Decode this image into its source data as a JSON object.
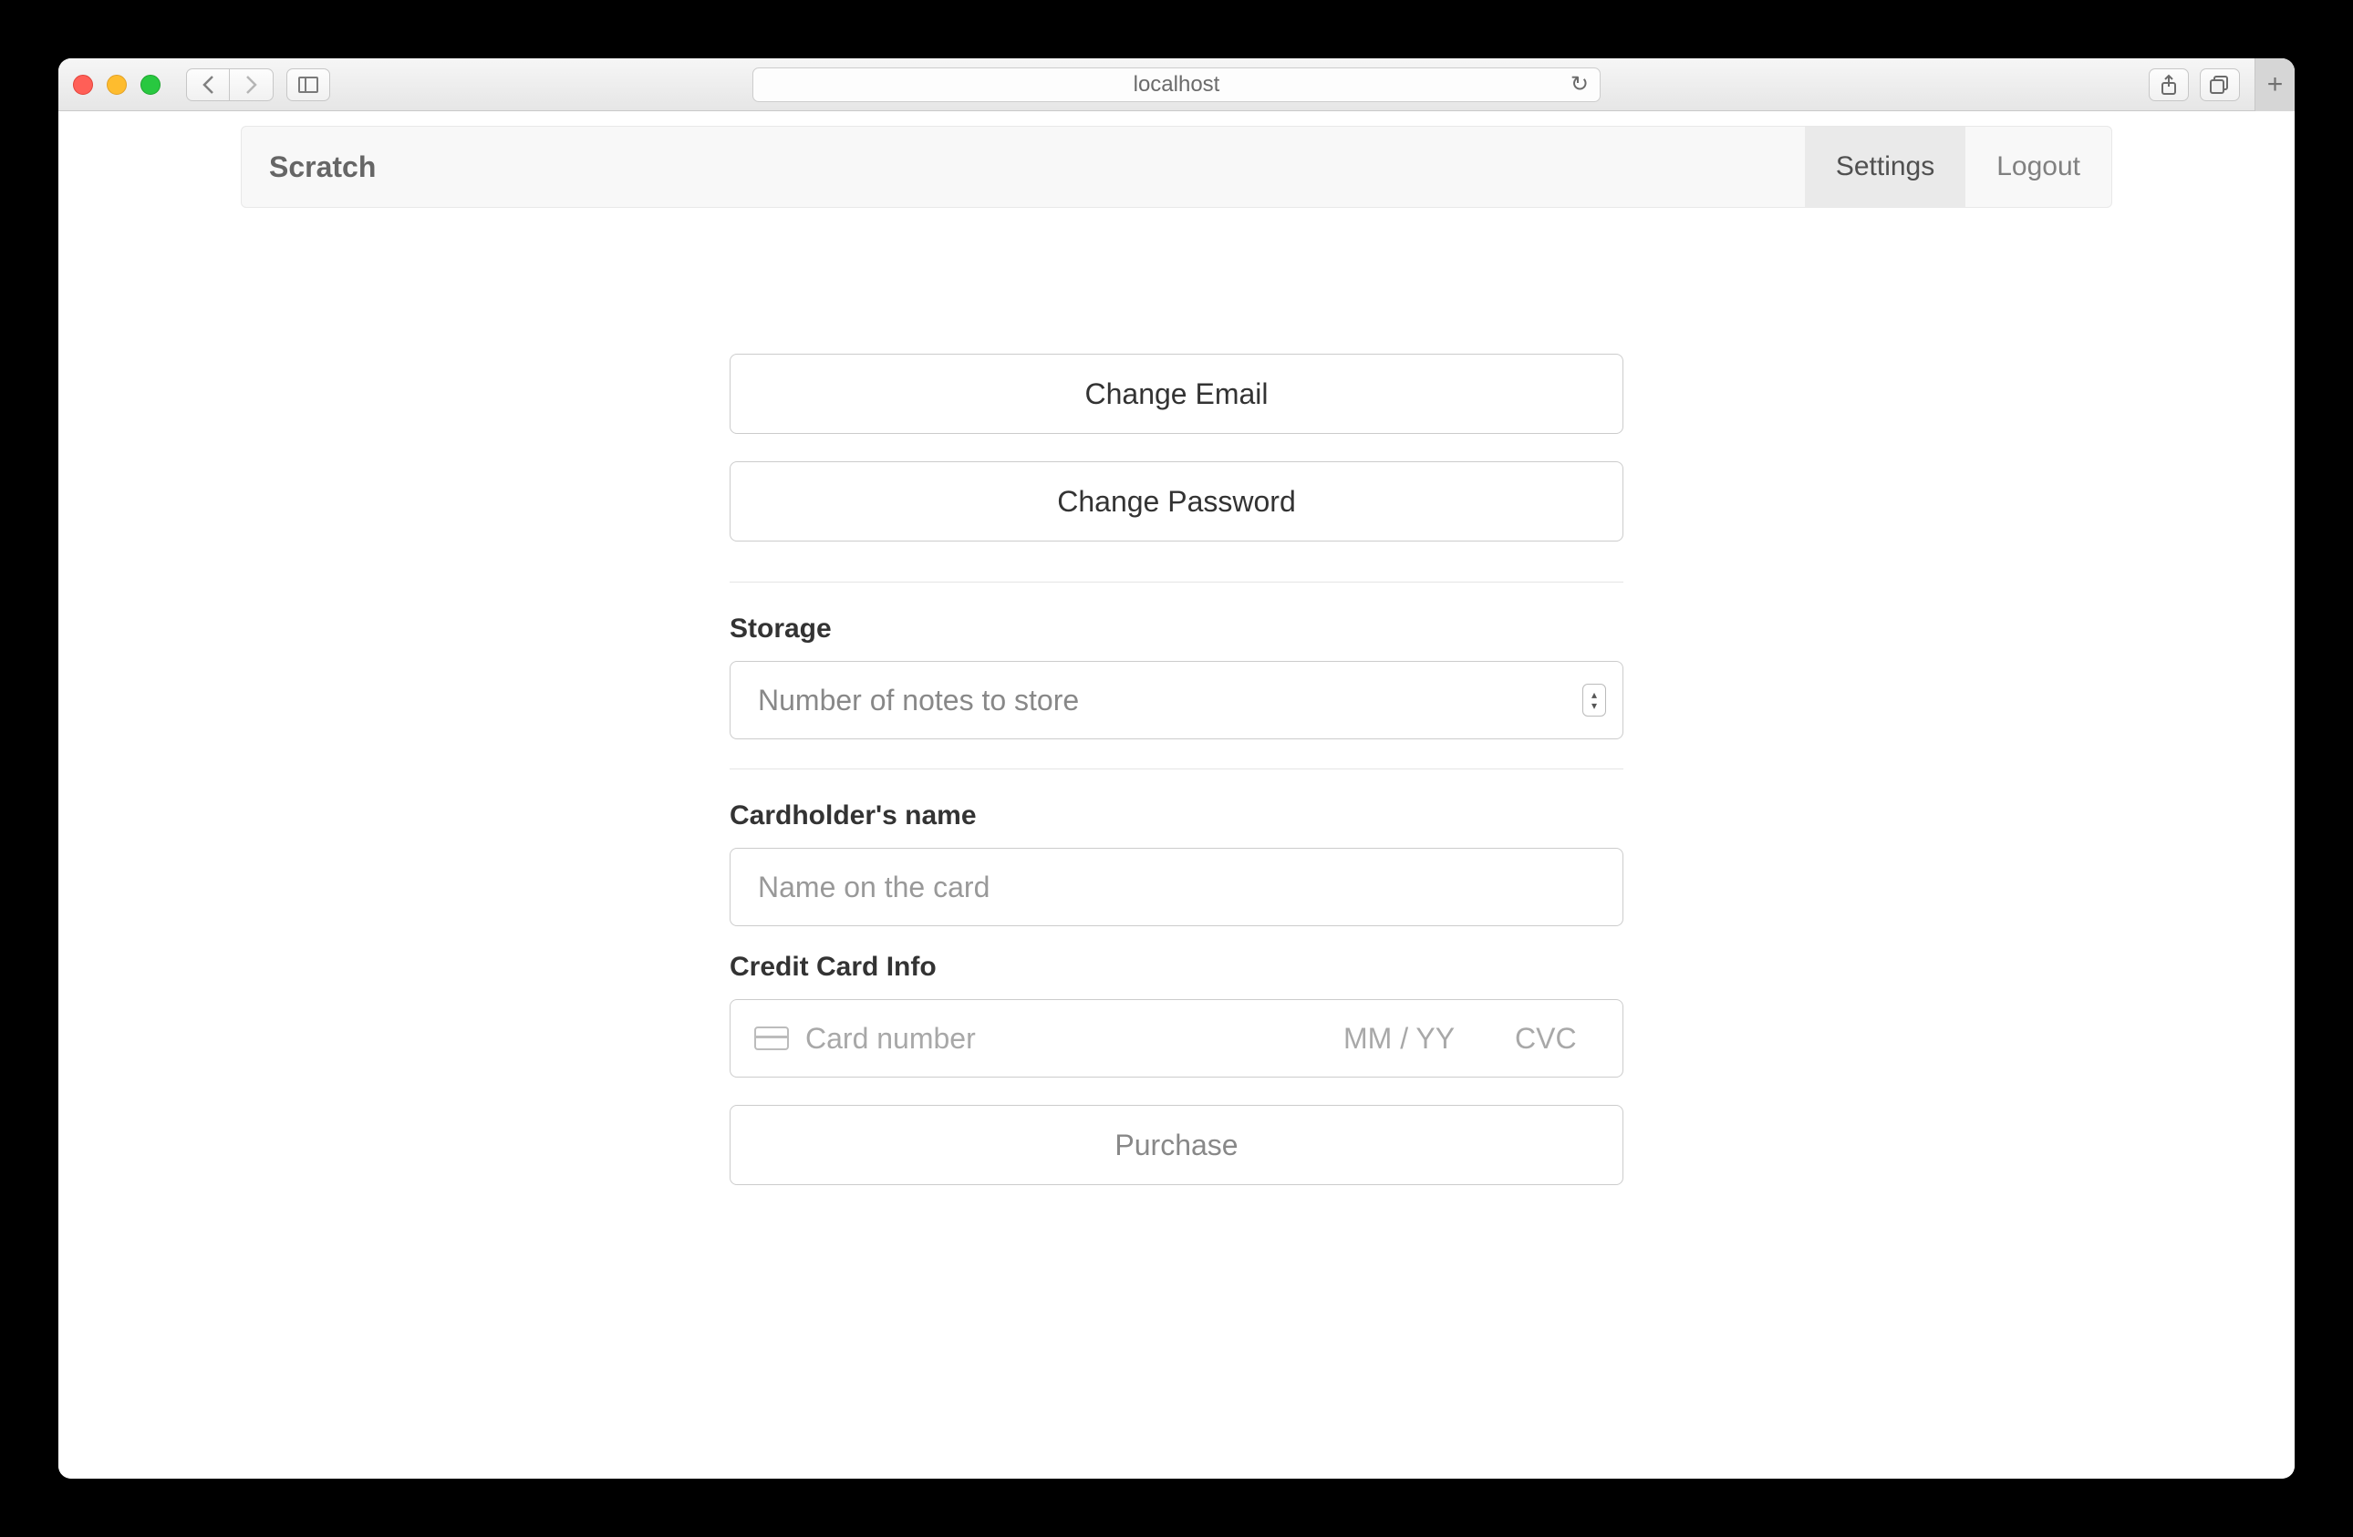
{
  "browser": {
    "url_display": "localhost"
  },
  "nav": {
    "brand": "Scratch",
    "settings": "Settings",
    "logout": "Logout"
  },
  "buttons": {
    "change_email": "Change Email",
    "change_password": "Change Password",
    "purchase": "Purchase"
  },
  "storage": {
    "label": "Storage",
    "placeholder": "Number of notes to store"
  },
  "card": {
    "name_label": "Cardholder's name",
    "name_placeholder": "Name on the card",
    "info_label": "Credit Card Info",
    "number_placeholder": "Card number",
    "expiry_placeholder": "MM / YY",
    "cvc_placeholder": "CVC"
  }
}
